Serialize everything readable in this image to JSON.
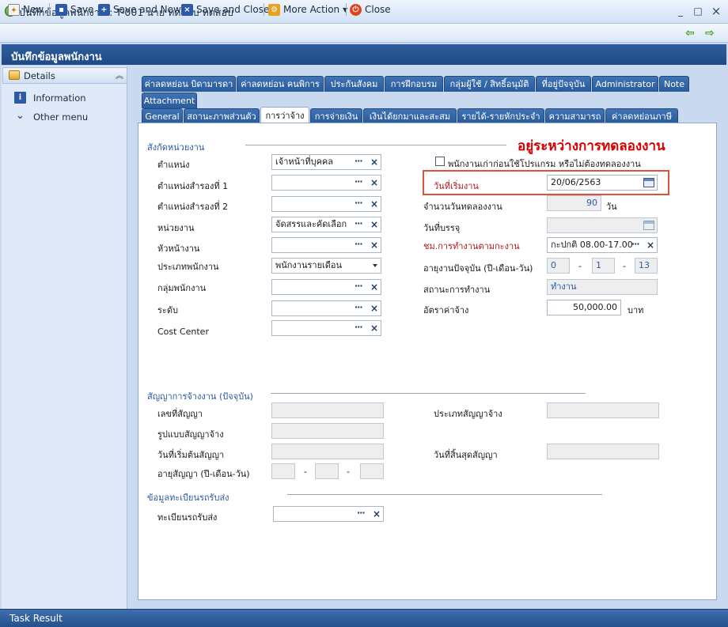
{
  "window": {
    "title": "บันทึกข้อมูลพนักงาน : T-001 นาย ทดสอบ ทดสอบ",
    "minimize": "_",
    "maximize": "□",
    "close": "×"
  },
  "toolbar": {
    "new": "New",
    "save": "Save",
    "save_new": "Save and New",
    "save_close": "Save and Close",
    "more_action": "More Action",
    "close": "Close"
  },
  "header": {
    "title": "บันทึกข้อมูลพนักงาน"
  },
  "sidebar": {
    "section": "Details",
    "items": [
      "Information",
      "Other menu"
    ]
  },
  "tabs_row1": [
    "ค่าลดหย่อน บิดามารดา",
    "ค่าลดหย่อน คนพิการ",
    "ประกันสังคม",
    "การฝึกอบรม",
    "กลุ่มผู้ใช้ / สิทธิ์อนุมัติ",
    "ที่อยู่ปัจจุบัน",
    "Administrator",
    "Note"
  ],
  "tabs_row1b": [
    "Attachment"
  ],
  "tabs_row2": [
    "General",
    "สถานะภาพส่วนตัว",
    "การว่าจ้าง",
    "การจ่ายเงิน",
    "เงินได้ยกมาและสะสม",
    "รายได้-รายหักประจำ",
    "ความสามารถ",
    "ค่าลดหย่อนภาษี"
  ],
  "status_text": "อยู่ระหว่างการทดลองงาน",
  "section1": {
    "title": "สังกัดหน่วยงาน",
    "labels": [
      "ตำแหน่ง",
      "ตำแหน่งสำรองที่ 1",
      "ตำแหน่งสำรองที่ 2",
      "หน่วยงาน",
      "หัวหน้างาน",
      "ประเภทพนักงาน",
      "กลุ่มพนักงาน",
      "ระดับ",
      "Cost Center"
    ],
    "values": {
      "position": "เจ้าหน้าที่บุคคล",
      "department": "จัดสรรและคัดเลือก",
      "employee_type": "พนักงานรายเดือน"
    },
    "checkbox_label": "พนักงานเก่าก่อนใช้โปรแกรม หรือไม่ต้องทดลองงาน",
    "right_labels": {
      "start_date": "วันที่เริ่มงาน",
      "probation_days": "จำนวนวันทดลองงาน",
      "confirm_date": "วันที่บรรจุ",
      "work_hours": "ชม.การทำงานตามกะงาน",
      "current_age": "อายุงานปัจจุบัน (ปี-เดือน-วัน)",
      "work_status": "สถานะการทำงาน",
      "salary": "อัตราค่าจ้าง"
    },
    "right_values": {
      "start_date": "20/06/2563",
      "probation_days": "90",
      "probation_unit": "วัน",
      "work_hours": "กะปกติ 08.00-17.00",
      "age_years": "0",
      "age_months": "1",
      "age_days": "13",
      "age_sep": "-",
      "work_status": "ทำงาน",
      "salary": "50,000.00",
      "salary_unit": "บาท"
    }
  },
  "section2": {
    "title": "สัญญาการจ้างงาน (ปัจจุบัน)",
    "labels": {
      "contract_no": "เลขที่สัญญา",
      "contract_type": "ประเภทสัญญาจ้าง",
      "contract_form": "รูปแบบสัญญาจ้าง",
      "contract_start": "วันที่เริ่มต้นสัญญา",
      "contract_end": "วันที่สิ้นสุดสัญญา",
      "contract_age": "อายุสัญญา (ปี-เดือน-วัน)"
    },
    "sep": "-"
  },
  "section3": {
    "title": "ข้อมูลทะเบียนรถรับส่ง",
    "label": "ทะเบียนรถรับส่ง"
  },
  "footer": {
    "task_result": "Task Result"
  },
  "colors": {
    "header_blue": "#1e4a86",
    "tab_blue": "#2a5b9b",
    "status_red": "#d40000",
    "highlight": "#e0503a"
  }
}
